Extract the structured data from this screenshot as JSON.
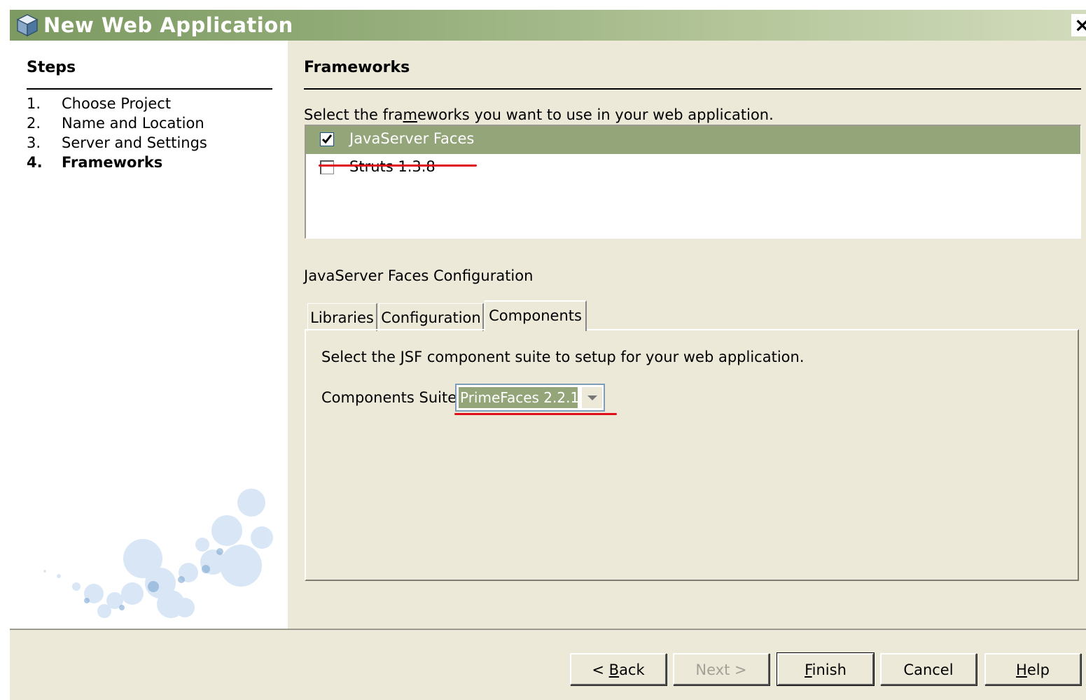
{
  "window": {
    "title": "New Web Application",
    "close_glyph": "×",
    "icon": "cube-icon"
  },
  "steps": {
    "title": "Steps",
    "items": [
      {
        "num": "1.",
        "label": "Choose Project"
      },
      {
        "num": "2.",
        "label": "Name and Location"
      },
      {
        "num": "3.",
        "label": "Server and Settings"
      },
      {
        "num": "4.",
        "label": "Frameworks"
      }
    ],
    "current_index": 3
  },
  "frameworks": {
    "title": "Frameworks",
    "instruction_before": "Select the fra",
    "instruction_mnemonic": "m",
    "instruction_after": "eworks you want to use in your web application.",
    "items": [
      {
        "label": "JavaServer Faces",
        "checked": true,
        "selected": true
      },
      {
        "label": "Struts 1.3.8",
        "checked": false,
        "selected": false
      }
    ]
  },
  "config": {
    "title": "JavaServer Faces Configuration",
    "tabs": [
      {
        "label": "Libraries",
        "active": false
      },
      {
        "label": "Configuration",
        "active": false
      },
      {
        "label": "Components",
        "active": true
      }
    ],
    "panel_instruction": "Select the JSF component suite to setup for your web application.",
    "suite_label": "Components Suite:",
    "suite_value": "PrimeFaces 2.2.1"
  },
  "buttons": {
    "back": {
      "pre": "< ",
      "mn": "B",
      "post": "ack"
    },
    "next": {
      "pre": "Next >",
      "mn": "",
      "post": ""
    },
    "finish": {
      "pre": "",
      "mn": "F",
      "post": "inish"
    },
    "cancel": {
      "pre": "Cancel",
      "mn": "",
      "post": ""
    },
    "help": {
      "pre": "",
      "mn": "H",
      "post": "elp"
    }
  },
  "colors": {
    "title_bar": "#7c9a62",
    "selection": "#94a57a",
    "dialog_bg": "#ece9d8",
    "annotation": "#e0101a"
  }
}
